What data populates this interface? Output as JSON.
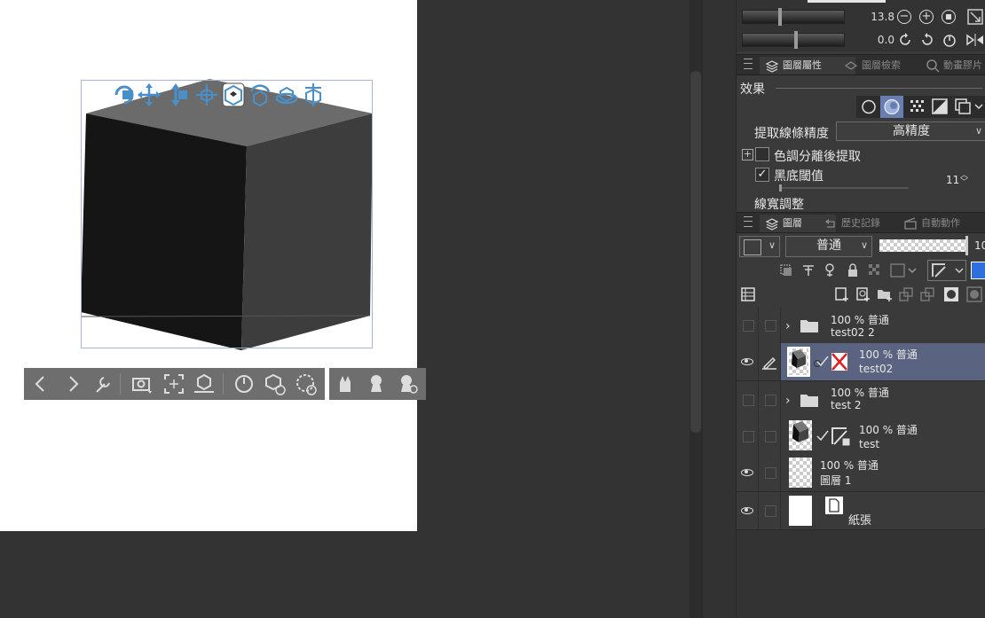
{
  "toolbar_top": {
    "value1": "13.8",
    "value2": "0.0"
  },
  "props_tabs": [
    {
      "label": "圖層屬性",
      "active": true
    },
    {
      "label": "圖層檢索",
      "active": false
    },
    {
      "label": "動畫膠片",
      "active": false
    }
  ],
  "effect": {
    "section_label": "效果",
    "extract_label": "提取線條精度",
    "extract_value": "高精度",
    "tone_sep_label": "色調分離後提取",
    "black_threshold_label": "黑底閾值",
    "black_threshold_value": "11",
    "line_width_label": "線寬調整"
  },
  "layer_tabs": [
    {
      "label": "圖層",
      "active": true
    },
    {
      "label": "歷史記錄",
      "active": false
    },
    {
      "label": "自動動作",
      "active": false
    }
  ],
  "layer_toolbar": {
    "blend_mode": "普通",
    "opacity_text": "10"
  },
  "layers": [
    {
      "mode": "100 % 普通",
      "name": "test02 2",
      "type": "folder",
      "visible": false,
      "selected": false
    },
    {
      "mode": "100 % 普通",
      "name": "test02",
      "type": "3d",
      "visible": true,
      "selected": true
    },
    {
      "mode": "100 % 普通",
      "name": "test 2",
      "type": "folder",
      "visible": false,
      "selected": false
    },
    {
      "mode": "100 % 普通",
      "name": "test",
      "type": "3d",
      "visible": false,
      "selected": false
    },
    {
      "mode": "100 % 普通",
      "name": "圖層 1",
      "type": "raster",
      "visible": true,
      "selected": false
    },
    {
      "mode": "",
      "name": "紙張",
      "type": "paper",
      "visible": true,
      "selected": false
    }
  ],
  "colors": {
    "panel_bg": "#3a3a3a",
    "selected_layer": "#5a6480",
    "gizmo_blue": "#4a90c8",
    "cube_front": "#151515",
    "cube_right": "#3d3d3d",
    "cube_top": "#6b6b6b"
  }
}
